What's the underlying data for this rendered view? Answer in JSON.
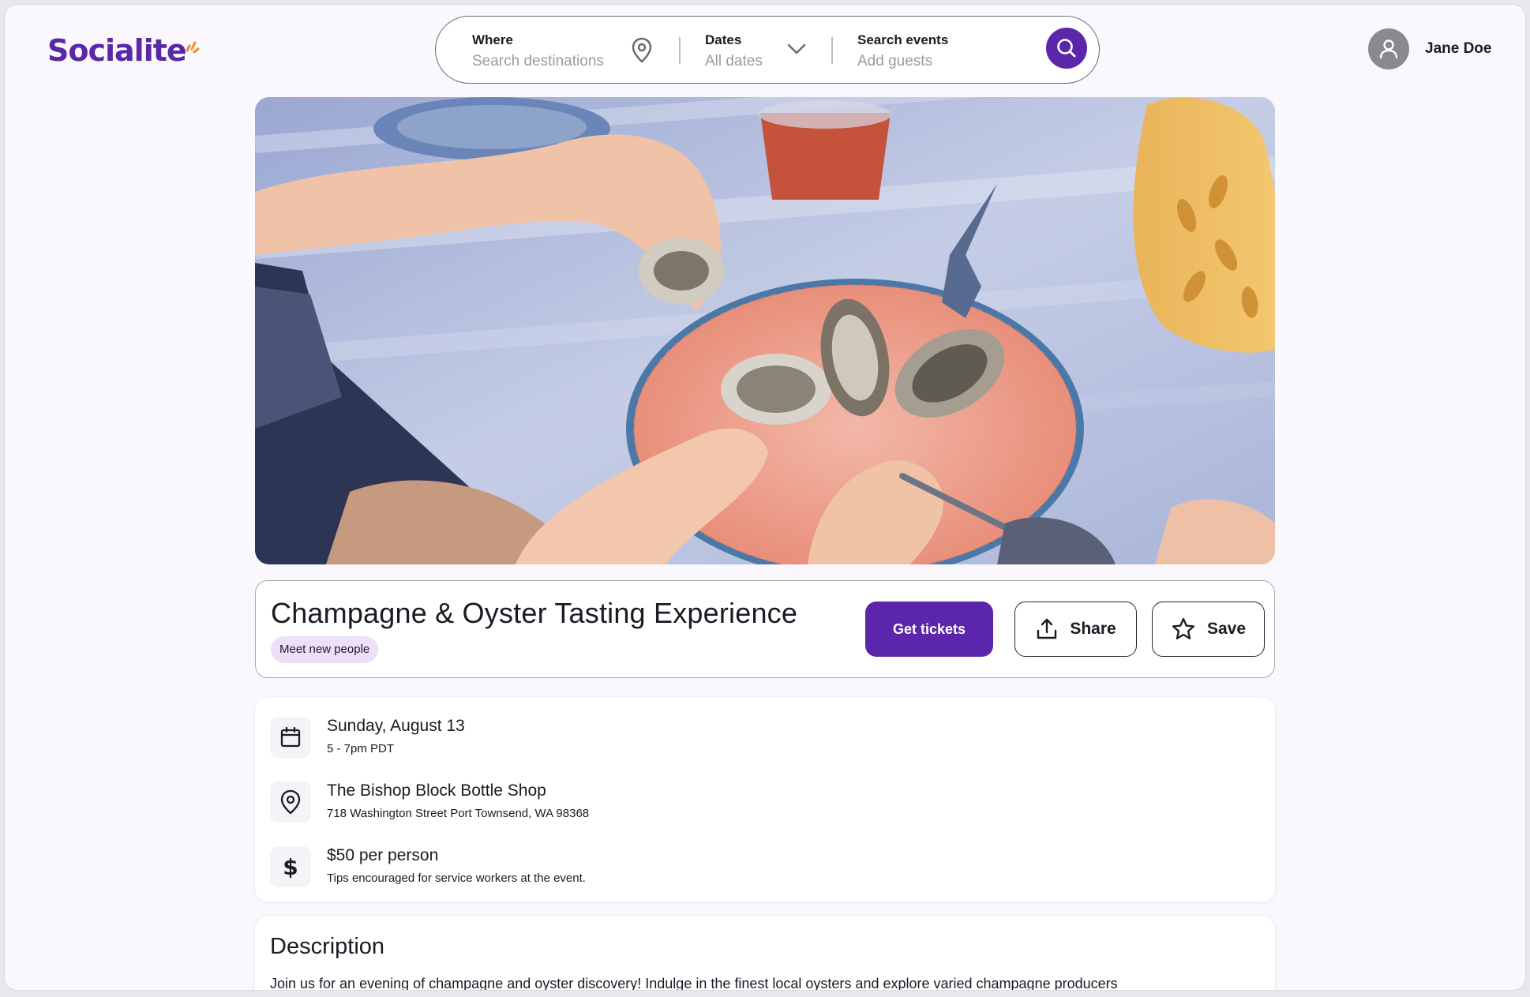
{
  "brand": {
    "name": "Socialite",
    "accent": "#5b26ac",
    "spark": "#f08a24"
  },
  "search": {
    "where": {
      "label": "Where",
      "placeholder": "Search destinations"
    },
    "dates": {
      "label": "Dates",
      "value": "All dates"
    },
    "events": {
      "label": "Search events",
      "placeholder": "Add guests"
    },
    "icons": [
      "map-pin-icon",
      "chevron-down-icon",
      "search-icon"
    ]
  },
  "user": {
    "name": "Jane Doe",
    "icon": "user-icon"
  },
  "hero": {
    "icon": "hero-photo"
  },
  "event": {
    "title": "Champagne & Oyster Tasting Experience",
    "tag": "Meet new people",
    "actions": {
      "tickets": "Get tickets",
      "share": "Share",
      "save": "Save"
    }
  },
  "details": {
    "date": {
      "main": "Sunday, August 13",
      "sub": "5 - 7pm PDT",
      "icon": "calendar-icon"
    },
    "venue": {
      "main": "The Bishop Block Bottle Shop",
      "sub": "718 Washington Street Port Townsend, WA 98368",
      "icon": "location-icon"
    },
    "price": {
      "main": "$50 per person",
      "sub": "Tips encouraged for service workers at the event.",
      "icon": "dollar-icon"
    }
  },
  "description": {
    "heading": "Description",
    "text": "Join us for an evening of champagne and oyster discovery! Indulge in the finest local oysters and explore varied champagne producers"
  }
}
